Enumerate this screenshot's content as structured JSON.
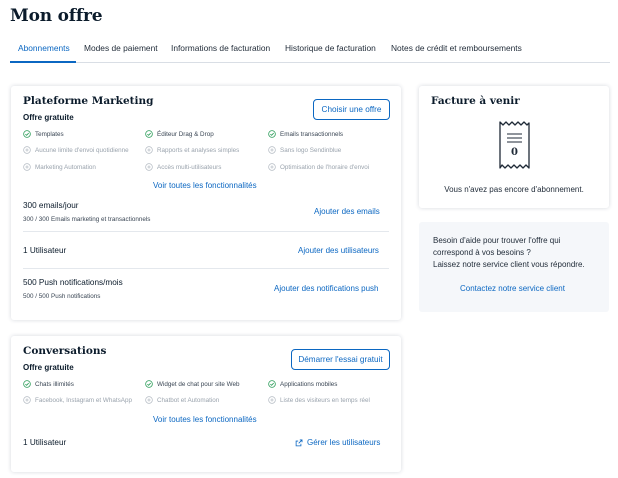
{
  "page": {
    "title": "Mon offre"
  },
  "tabs": [
    {
      "label": "Abonnements",
      "active": true
    },
    {
      "label": "Modes de paiement"
    },
    {
      "label": "Informations de facturation"
    },
    {
      "label": "Historique de facturation"
    },
    {
      "label": "Notes de crédit et remboursements"
    }
  ],
  "marketing": {
    "title": "Plateforme Marketing",
    "plan": "Offre gratuite",
    "cta": "Choisir une offre",
    "features": [
      {
        "label": "Templates",
        "included": true
      },
      {
        "label": "Éditeur Drag & Drop",
        "included": true
      },
      {
        "label": "Emails transactionnels",
        "included": true
      },
      {
        "label": "Aucune limite d'envoi quotidienne",
        "included": false
      },
      {
        "label": "Rapports et analyses simples",
        "included": false
      },
      {
        "label": "Sans logo Sendinblue",
        "included": false
      },
      {
        "label": "Marketing Automation",
        "included": false
      },
      {
        "label": "Accès multi-utilisateurs",
        "included": false
      },
      {
        "label": "Optimisation de l'horaire d'envoi",
        "included": false
      }
    ],
    "see_all": "Voir toutes les fonctionnalités",
    "emails": {
      "title": "300 emails/jour",
      "sub": "300 / 300 Emails marketing et transactionnels",
      "action": "Ajouter des emails"
    },
    "users": {
      "title": "1 Utilisateur",
      "action": "Ajouter des utilisateurs"
    },
    "push": {
      "title": "500 Push notifications/mois",
      "sub": "500 / 500 Push notifications",
      "action": "Ajouter des notifications push"
    }
  },
  "conversations": {
    "title": "Conversations",
    "plan": "Offre gratuite",
    "cta": "Démarrer l'essai gratuit",
    "features": [
      {
        "label": "Chats illimités",
        "included": true
      },
      {
        "label": "Widget de chat pour site Web",
        "included": true
      },
      {
        "label": "Applications mobiles",
        "included": true
      },
      {
        "label": "Facebook, Instagram et WhatsApp",
        "included": false
      },
      {
        "label": "Chatbot et Automation",
        "included": false
      },
      {
        "label": "Liste des visiteurs en temps réel",
        "included": false
      }
    ],
    "see_all": "Voir toutes les fonctionnalités",
    "users": {
      "title": "1 Utilisateur",
      "action": "Gérer les utilisateurs"
    }
  },
  "invoice": {
    "title": "Facture à venir",
    "receipt_value": "0",
    "empty": "Vous n'avez pas encore d'abonnement."
  },
  "help": {
    "line1": "Besoin d'aide pour trouver l'offre qui",
    "line2": "correspond à vos besoins ?",
    "line3": "Laissez notre service client vous répondre.",
    "link": "Contactez notre service client"
  },
  "colors": {
    "accent": "#0b67c2",
    "check": "#2e9e5b",
    "muted": "#9aa3ad"
  }
}
